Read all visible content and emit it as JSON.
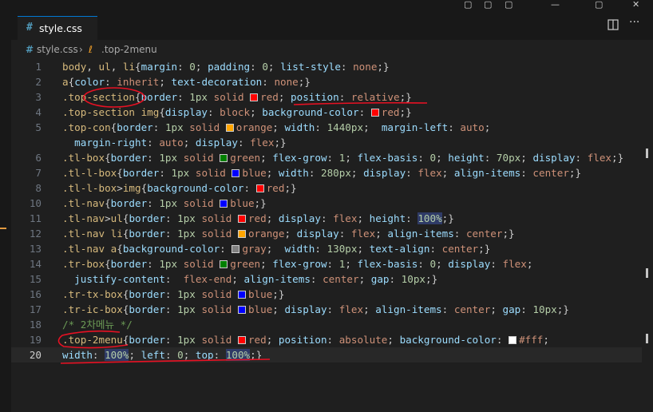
{
  "tab": {
    "icon": "#",
    "label": "style.css"
  },
  "tab_actions": [
    "split-editor-icon",
    "more-actions-icon"
  ],
  "breadcrumb": {
    "file": "style.css",
    "symbol": ".top-2menu"
  },
  "colors": {
    "red": "#ff0000",
    "orange": "#ffa500",
    "green": "#008000",
    "blue": "#0000ff",
    "gray": "#808080",
    "white": "#ffffff",
    "annotation": "#e81123"
  },
  "code_lines": [
    {
      "n": "1",
      "t": "body, ul, li{margin: 0; padding: 0; list-style: none;}"
    },
    {
      "n": "2",
      "t": "a{color: inherit; text-decoration: none;}"
    },
    {
      "n": "3",
      "t": ".top-section{border: 1px solid red; position: relative;}"
    },
    {
      "n": "4",
      "t": ".top-section img{display: block; background-color: red;}"
    },
    {
      "n": "5",
      "t": ".top-con{border: 1px solid orange; width: 1440px;  margin-left: auto;"
    },
    {
      "n": "",
      "t": "  margin-right: auto; display: flex;}"
    },
    {
      "n": "6",
      "t": ".tl-box{border: 1px solid green; flex-grow: 1; flex-basis: 0; height: 70px; display: flex;}"
    },
    {
      "n": "7",
      "t": ".tl-l-box{border: 1px solid blue; width: 280px; display: flex; align-items: center;}"
    },
    {
      "n": "8",
      "t": ".tl-l-box>img{background-color: red;}"
    },
    {
      "n": "10",
      "t": ".tl-nav{border: 1px solid blue;}"
    },
    {
      "n": "11",
      "t": ".tl-nav>ul{border: 1px solid red; display: flex; height: 100%;}"
    },
    {
      "n": "12",
      "t": ".tl-nav li{border: 1px solid orange; display: flex; align-items: center;}"
    },
    {
      "n": "13",
      "t": ".tl-nav a{background-color: gray;  width: 130px; text-align: center;}"
    },
    {
      "n": "14",
      "t": ".tr-box{border: 1px solid green; flex-grow: 1; flex-basis: 0; display: flex;"
    },
    {
      "n": "15",
      "t": "  justify-content:  flex-end; align-items: center; gap: 10px;}"
    },
    {
      "n": "16",
      "t": ".tr-tx-box{border: 1px solid blue;}"
    },
    {
      "n": "17",
      "t": ".tr-ic-box{border: 1px solid blue; display: flex; align-items: center; gap: 10px;}"
    },
    {
      "n": "18",
      "t": "/* 2차메뉴 */"
    },
    {
      "n": "19",
      "t": ".top-2menu{border: 1px solid red; position: absolute; background-color: #fff;"
    },
    {
      "n": "20",
      "t": "width: 100%; left: 0; top: 100%;}"
    }
  ]
}
